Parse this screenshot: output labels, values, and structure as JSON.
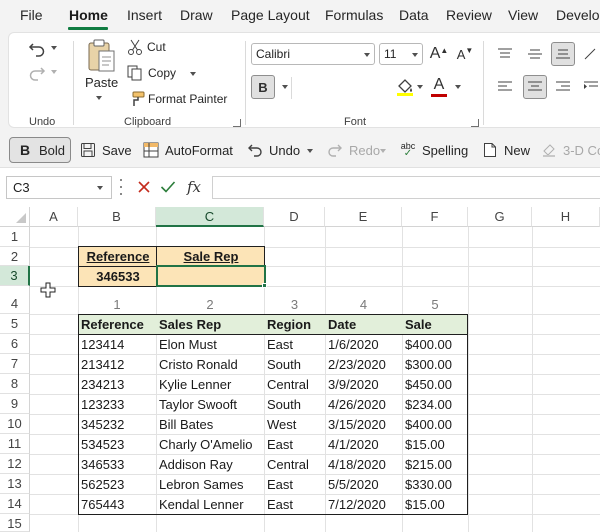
{
  "menu": {
    "tabs": [
      "File",
      "Home",
      "Insert",
      "Draw",
      "Page Layout",
      "Formulas",
      "Data",
      "Review",
      "View",
      "Develop"
    ],
    "active_tab": "Home"
  },
  "ribbon": {
    "undo_group_label": "Undo",
    "clipboard": {
      "paste": "Paste",
      "cut": "Cut",
      "copy": "Copy",
      "format_painter": "Format Painter",
      "group_label": "Clipboard"
    },
    "font": {
      "family": "Calibri",
      "size": "11",
      "grow_label": "A",
      "shrink_label": "A",
      "bold_label": "B",
      "font_color_label": "A",
      "group_label": "Font"
    }
  },
  "qat": {
    "bold": "Bold",
    "save": "Save",
    "autoformat": "AutoFormat",
    "undo": "Undo",
    "redo": "Redo",
    "spelling": "Spelling",
    "new": "New",
    "color": "3-D Co"
  },
  "formula_bar": {
    "name_box": "C3",
    "fx_label": "fx",
    "formula": ""
  },
  "grid": {
    "columns": [
      "A",
      "B",
      "C",
      "D",
      "E",
      "F",
      "G",
      "H"
    ],
    "rows": [
      "1",
      "2",
      "3",
      "4",
      "5",
      "6",
      "7",
      "8",
      "9",
      "10",
      "11",
      "12",
      "13",
      "14",
      "15"
    ],
    "selected_cell": "C3"
  },
  "lookup": {
    "reference_label": "Reference",
    "salerep_label": "Sale Rep",
    "reference_value": "346533",
    "salerep_value": ""
  },
  "column_index": [
    "1",
    "2",
    "3",
    "4",
    "5"
  ],
  "table": {
    "headers": [
      "Reference",
      "Sales Rep",
      "Region",
      "Date",
      "Sale"
    ],
    "rows": [
      [
        "123414",
        "Elon Must",
        "East",
        "1/6/2020",
        "$400.00"
      ],
      [
        "213412",
        "Cristo Ronald",
        "South",
        "2/23/2020",
        "$300.00"
      ],
      [
        "234213",
        "Kylie Lenner",
        "Central",
        "3/9/2020",
        "$450.00"
      ],
      [
        "123233",
        "Taylor Swooft",
        "South",
        "4/26/2020",
        "$234.00"
      ],
      [
        "345232",
        "Bill Bates",
        "West",
        "3/15/2020",
        "$400.00"
      ],
      [
        "534523",
        "Charly O'Amelio",
        "East",
        "4/1/2020",
        "$15.00"
      ],
      [
        "346533",
        "Addison Ray",
        "Central",
        "4/18/2020",
        "$215.00"
      ],
      [
        "562523",
        "Lebron Sames",
        "East",
        "5/5/2020",
        "$330.00"
      ],
      [
        "765443",
        "Kendal Lenner",
        "East",
        "7/12/2020",
        "$15.00"
      ]
    ]
  },
  "colors": {
    "accent": "#107c41",
    "selection": "#217346",
    "lookup_fill": "#fce4b7",
    "table_header_fill": "#e2efda",
    "font_color_swatch": "#c00000"
  }
}
